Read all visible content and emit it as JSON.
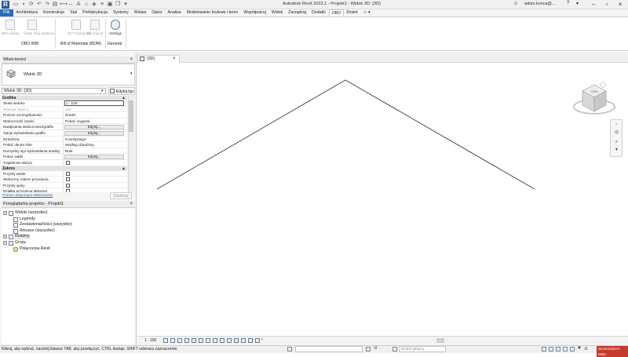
{
  "app": {
    "logo_letter": "R",
    "title": "Autodesk Revit 2022.1 - Projekt1 - Widok 3D: {3D}",
    "user": "adam.konca@...",
    "help_icon": "?"
  },
  "ribbon": {
    "tabs": [
      "Plik",
      "Architektura",
      "Konstrukcje",
      "Stal",
      "Prefabrykacja",
      "Systemy",
      "Wstaw",
      "Opisz",
      "Analiza",
      "Modelowanie bryłowe i teren",
      "Współpracuj",
      "Widok",
      "Zarządzaj",
      "Dodatki",
      "OBO",
      "Zmień"
    ],
    "active_tab": "OBO",
    "buttons": [
      {
        "label": "BIM Library",
        "enabled": false
      },
      {
        "label": "Cable Tray Systems",
        "enabled": false
      },
      {
        "label": "RVT Schedules",
        "enabled": false
      },
      {
        "label": "File Export",
        "enabled": false
      },
      {
        "label": "Settings",
        "enabled": true
      }
    ],
    "groups": [
      "OBO BIM",
      "Bill of Materials (BOM)",
      "General"
    ]
  },
  "properties": {
    "title": "Właściwości",
    "type_name": "Widok 3D",
    "view_selector": "Widok 3D: {3D}",
    "edit_type": "Edytuj typ",
    "groups": [
      {
        "name": "Grafika",
        "rows": [
          {
            "key": "Skala widoku",
            "value": "1 : 100",
            "kind": "box"
          },
          {
            "key": "Wartość skali   1:",
            "value": "100",
            "kind": "disabled"
          },
          {
            "key": "Poziom szczegółowości",
            "value": "Średni",
            "kind": "text"
          },
          {
            "key": "Widoczność części",
            "value": "Pokaż oryginał",
            "kind": "text"
          },
          {
            "key": "Nadpisania widoczności/grafiki",
            "value": "Edytuj...",
            "kind": "button"
          },
          {
            "key": "Opcje wyświetlania grafiki",
            "value": "Edytuj...",
            "kind": "button"
          },
          {
            "key": "Dziedzina",
            "value": "Koordynacja",
            "kind": "text"
          },
          {
            "key": "Pokaż ukryte linie",
            "value": "Według dziedziny",
            "kind": "text"
          },
          {
            "key": "Domyślny styl wyświetlania analizy",
            "value": "Brak",
            "kind": "text"
          },
          {
            "key": "Pokaż siatki",
            "value": "Edytuj...",
            "kind": "button"
          },
          {
            "key": "Trajektoria słońca",
            "value": "",
            "kind": "checkbox"
          }
        ]
      },
      {
        "name": "Zakres",
        "rows": [
          {
            "key": "Przytnij widok",
            "value": "",
            "kind": "checkbox"
          },
          {
            "key": "Widoczny zakres przycięcia",
            "value": "",
            "kind": "checkbox"
          },
          {
            "key": "Przytnij opisy",
            "value": "",
            "kind": "checkbox"
          },
          {
            "key": "Działka przycięcia aktywna",
            "value": "",
            "kind": "checkbox"
          }
        ]
      }
    ],
    "help_link": "Pomoc dotycząca właściwości",
    "apply": "Zastosuj"
  },
  "browser": {
    "title": "Przeglądarka projektu - Projekt1",
    "nodes": [
      {
        "label": "Widoki (wszystko)",
        "level": 0,
        "expander": "+",
        "icon": "views-icon"
      },
      {
        "label": "Legendy",
        "level": 1,
        "expander": "",
        "icon": "legend-icon"
      },
      {
        "label": "Zestawienia/Ilości (wszystko)",
        "level": 1,
        "expander": "",
        "icon": "schedule-icon"
      },
      {
        "label": "Arkusze (wszystko)",
        "level": 1,
        "expander": "",
        "icon": "sheet-icon"
      },
      {
        "label": "Rodziny",
        "level": 0,
        "expander": "+",
        "icon": "families-icon"
      },
      {
        "label": "Grupy",
        "level": 0,
        "expander": "+",
        "icon": "groups-icon"
      },
      {
        "label": "Połączenia Revit",
        "level": 1,
        "expander": "",
        "icon": "link-icon"
      }
    ]
  },
  "view": {
    "tab_label": "{3D}",
    "scale": "1 : 100",
    "viewcube": {
      "face": "GÓRA"
    }
  },
  "status": {
    "text": "Kliknij, aby wybrać, naciśnij klawisz TAB, aby przełączyć, CTRL dodaje, SHIFT odwraca zaznaczenie.",
    "workset_value": "",
    "model_placeholder": "Model główny",
    "filter_label": ":0",
    "watermark": "Screencast-O-Matic"
  }
}
